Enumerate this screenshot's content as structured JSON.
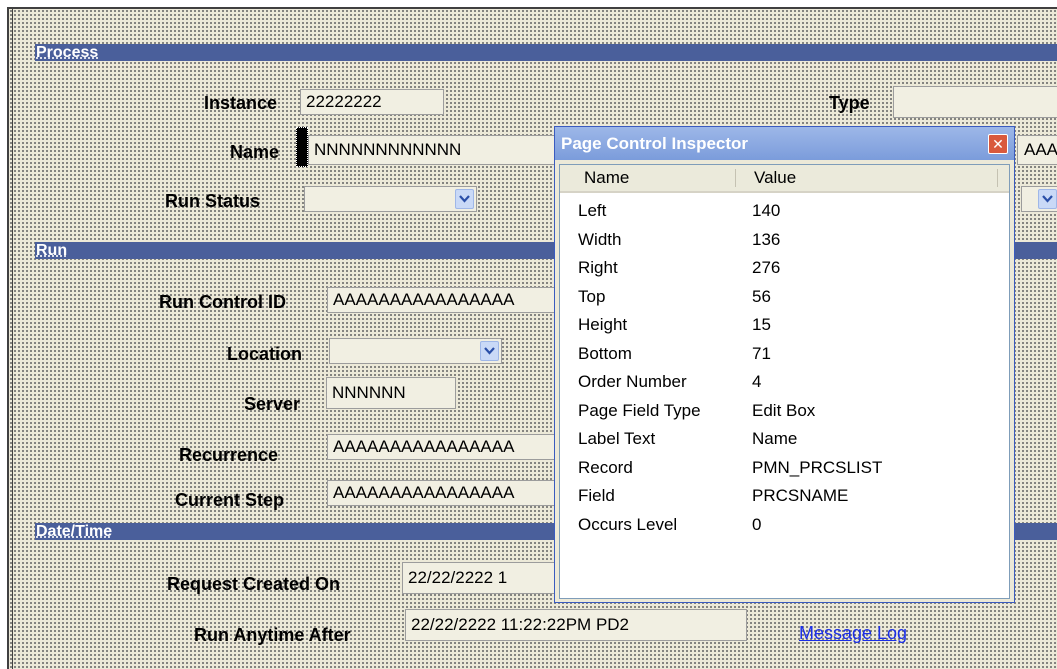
{
  "sections": {
    "process": "Process",
    "run": "Run",
    "datetime": "Date/Time"
  },
  "fields": {
    "instance": {
      "label": "Instance",
      "value": "22222222"
    },
    "type": {
      "label": "Type",
      "value": ""
    },
    "name": {
      "label": "Name",
      "value": "NNNNNNNNNNNN"
    },
    "name_right_value": "AAA",
    "run_status": {
      "label": "Run Status",
      "value": ""
    },
    "run_control_id": {
      "label": "Run Control ID",
      "value": "AAAAAAAAAAAAAAAA"
    },
    "location": {
      "label": "Location",
      "value": ""
    },
    "server": {
      "label": "Server",
      "value": "NNNNNN"
    },
    "recurrence": {
      "label": "Recurrence",
      "value": "AAAAAAAAAAAAAAAA"
    },
    "current_step": {
      "label": "Current Step",
      "value": "AAAAAAAAAAAAAAAA"
    },
    "request_created_on": {
      "label": "Request Created On",
      "value": "22/22/2222 1"
    },
    "run_anytime_after": {
      "label": "Run Anytime After",
      "value": "22/22/2222 11:22:22PM PD2"
    }
  },
  "links": {
    "message_log": "Message Log"
  },
  "inspector": {
    "title": "Page Control Inspector",
    "close_glyph": "✕",
    "columns": {
      "name": "Name",
      "value": "Value"
    },
    "rows": [
      {
        "name": "Left",
        "value": "140"
      },
      {
        "name": "Width",
        "value": "136"
      },
      {
        "name": "Right",
        "value": "276"
      },
      {
        "name": "Top",
        "value": "56"
      },
      {
        "name": "Height",
        "value": "15"
      },
      {
        "name": "Bottom",
        "value": "71"
      },
      {
        "name": "Order Number",
        "value": "4"
      },
      {
        "name": "Page Field Type",
        "value": "Edit Box"
      },
      {
        "name": "Label Text",
        "value": "Name"
      },
      {
        "name": "Record",
        "value": "PMN_PRCSLIST"
      },
      {
        "name": "Field",
        "value": "PRCSNAME"
      },
      {
        "name": "Occurs Level",
        "value": "0"
      }
    ]
  },
  "icons": {
    "dropdown": "chevron-down-icon",
    "close": "close-icon"
  },
  "colors": {
    "section_band": "#4a5f9b",
    "link": "#1a2ee8",
    "inspector_title": "#7b9cdb",
    "close_button": "#d9593d"
  }
}
